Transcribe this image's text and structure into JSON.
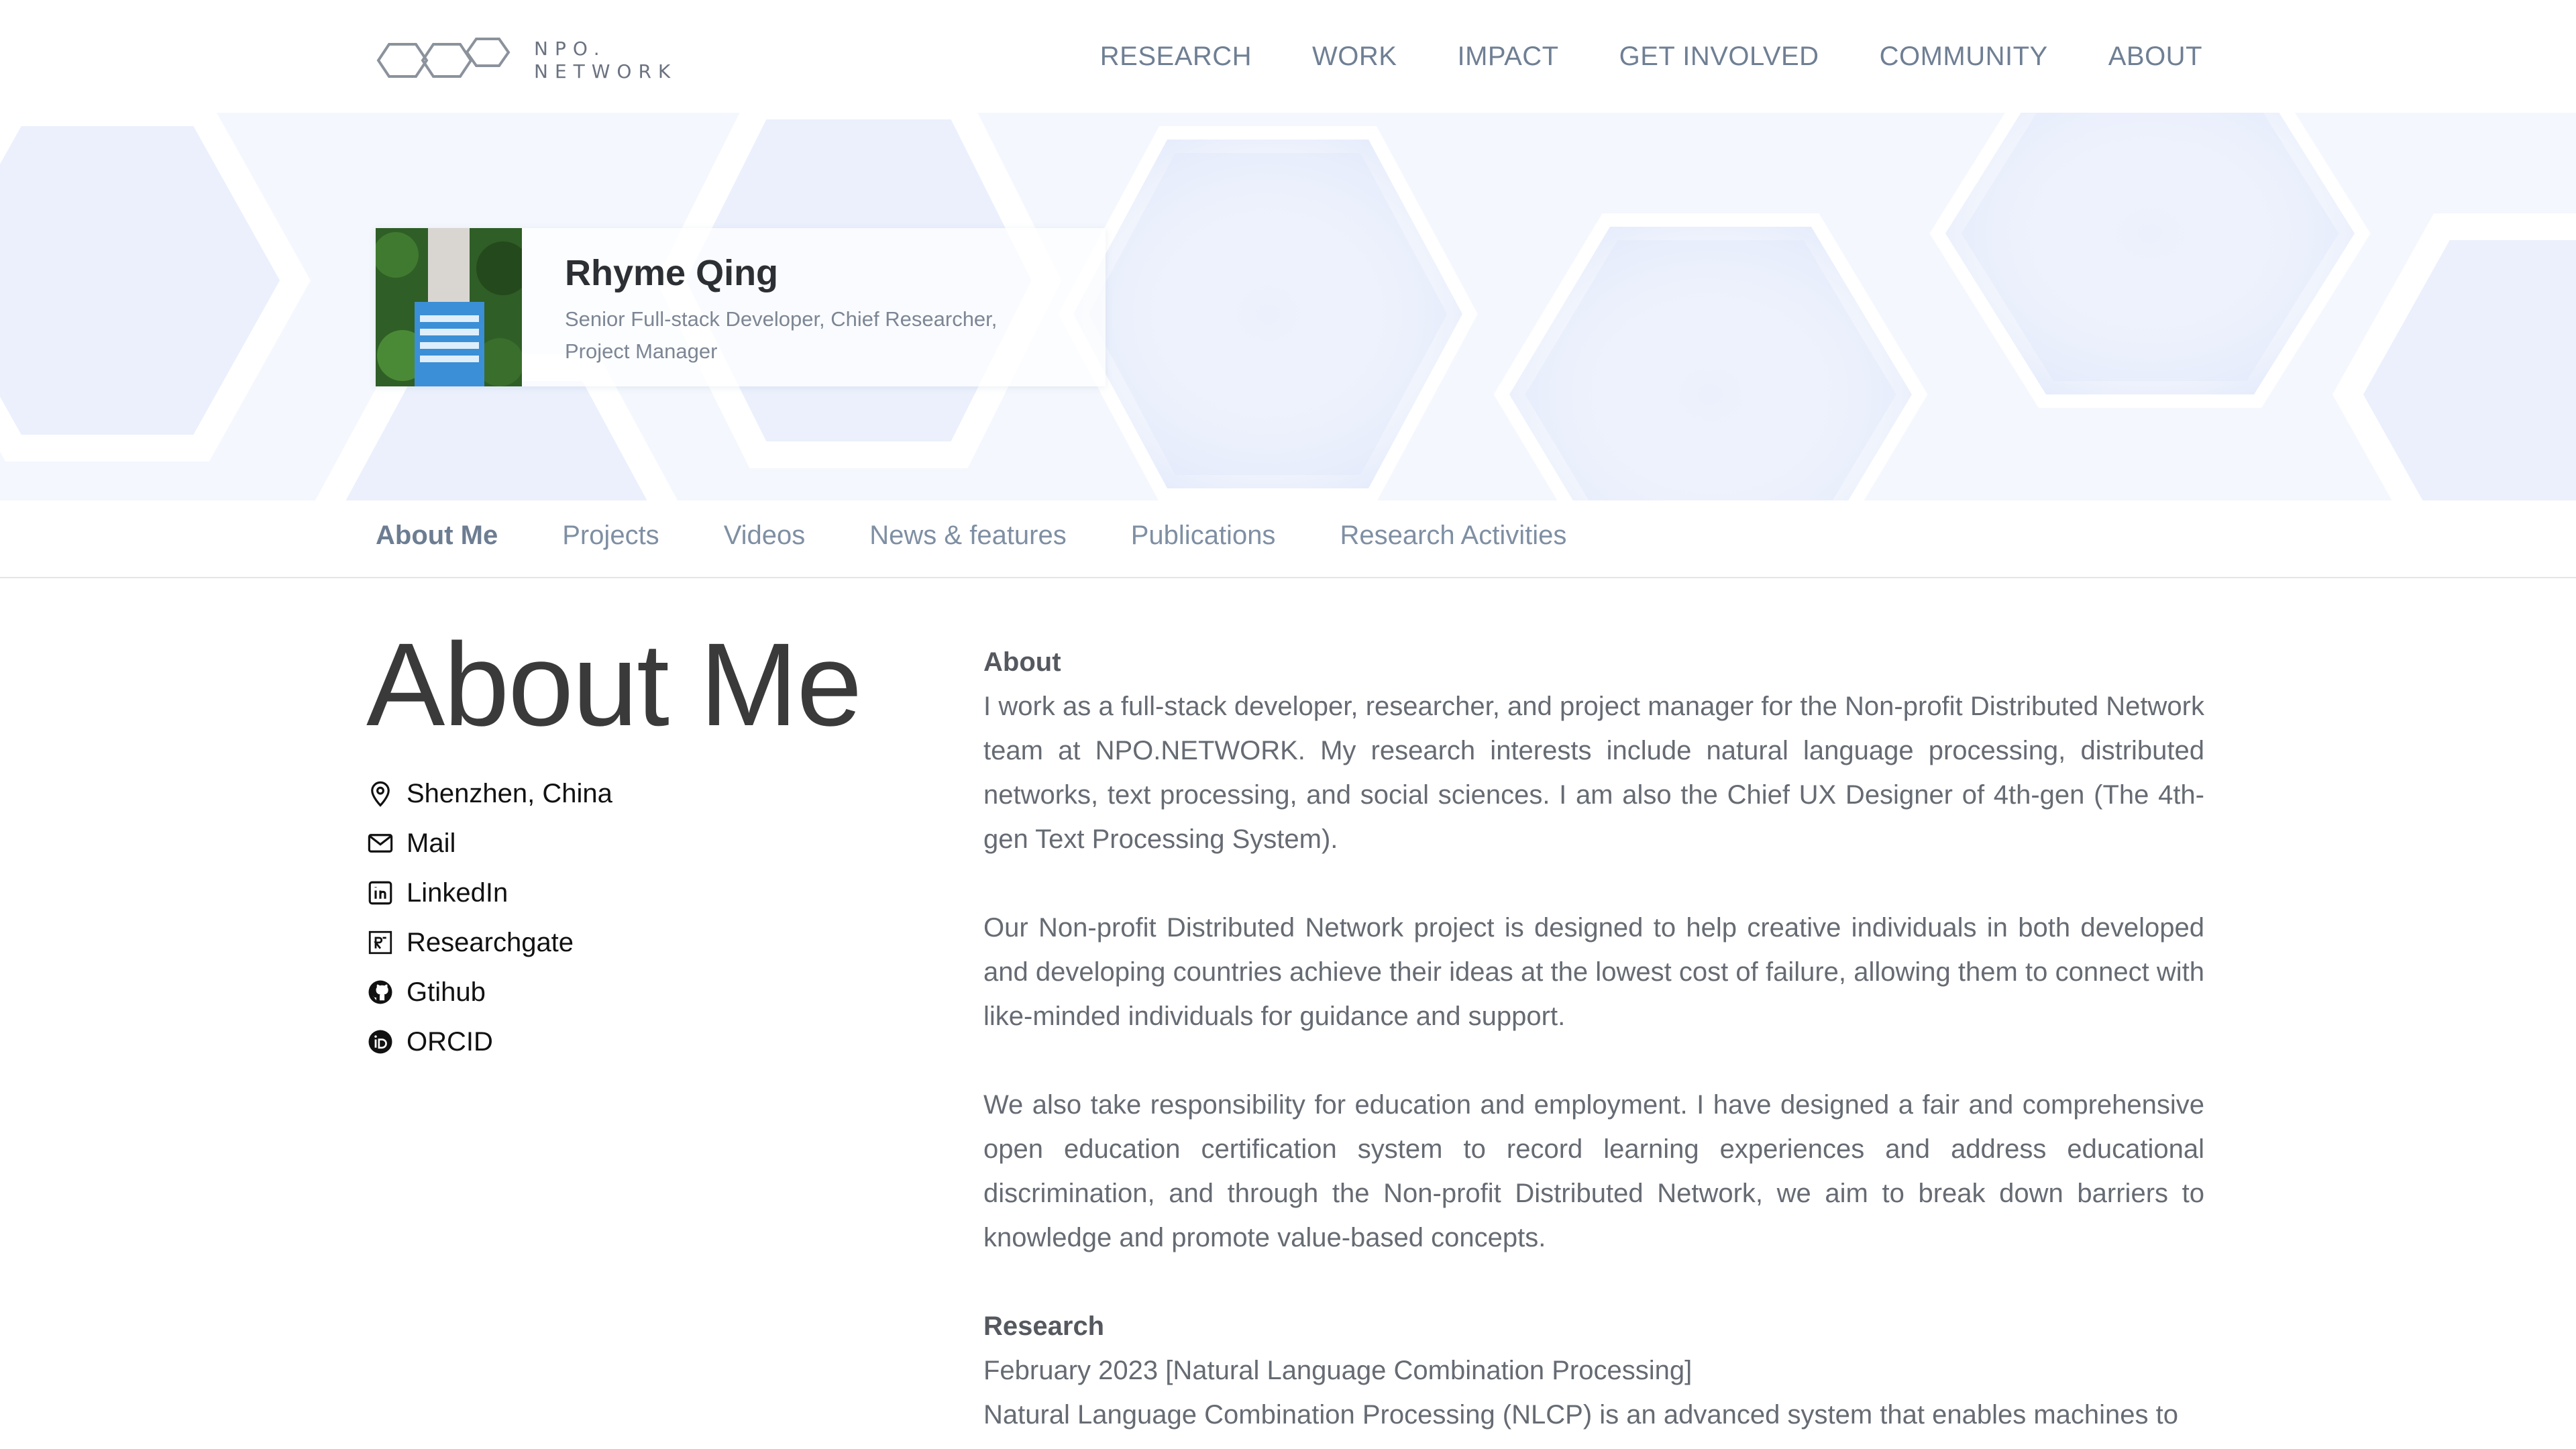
{
  "brand": {
    "line1": "NPO.",
    "line2": "NETWORK"
  },
  "topnav": [
    "RESEARCH",
    "WORK",
    "IMPACT",
    "GET INVOLVED",
    "COMMUNITY",
    "ABOUT"
  ],
  "profile": {
    "name": "Rhyme Qing",
    "role": "Senior Full-stack Developer, Chief Researcher, Project Manager"
  },
  "subnav": {
    "active": "About Me",
    "items": [
      "About Me",
      "Projects",
      "Videos",
      "News & features",
      "Publications",
      "Research Activities"
    ]
  },
  "about": {
    "title": "About Me",
    "contacts": [
      {
        "label": "Shenzhen, China",
        "icon": "location-pin-icon"
      },
      {
        "label": "Mail",
        "icon": "mail-icon"
      },
      {
        "label": "LinkedIn",
        "icon": "linkedin-icon"
      },
      {
        "label": "Researchgate",
        "icon": "researchgate-icon"
      },
      {
        "label": "Gtihub",
        "icon": "github-icon"
      },
      {
        "label": "ORCID",
        "icon": "orcid-icon"
      }
    ]
  },
  "content": {
    "about_heading": "About",
    "p1": "I work as a full-stack developer, researcher, and project manager for the Non-profit Distributed Network team at NPO.NETWORK. My research interests include natural language processing, distributed networks, text processing, and social sciences. I am also the Chief UX Designer of 4th-gen (The 4th-gen Text Processing System).",
    "p2": "Our Non-profit Distributed Network project is designed to help creative individuals in both developed and developing countries achieve their ideas at the lowest cost of failure, allowing them to connect with like-minded individuals for guidance and support.",
    "p3": "We also take responsibility for education and employment. I have designed a fair and comprehensive open education certification system to record learning experiences and address educational discrimination, and through the Non-profit Distributed Network, we aim to break down barriers to knowledge and promote value-based concepts.",
    "research_heading": "Research",
    "research_date": "February 2023 [Natural Language Combination Processing]",
    "research_text": "Natural Language Combination Processing (NLCP) is an advanced system that enables machines to"
  },
  "colors": {
    "nav_text": "#6f7f94",
    "hero_bg": "#f4f7fd",
    "hex_tint": "#e4ebfb",
    "body_text": "#666b73"
  }
}
